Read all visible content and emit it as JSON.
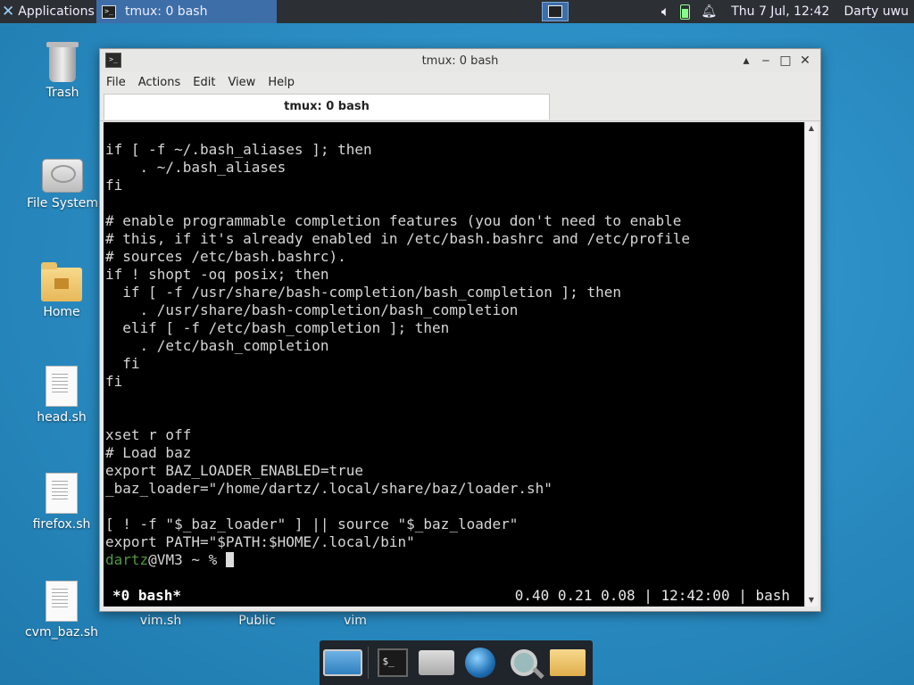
{
  "top_panel": {
    "apps_label": "Applications",
    "task_title": "tmux: 0 bash",
    "clock": "Thu  7 Jul, 12:42",
    "user": "Darty uwu",
    "icons": [
      "xfce-logo-icon",
      "terminal-icon",
      "workspace-icon",
      "volume-icon",
      "battery-icon",
      "notification-bell-icon"
    ]
  },
  "desktop": {
    "icons": [
      {
        "label": "Trash",
        "icon": "trash-icon"
      },
      {
        "label": "File System",
        "icon": "drive-icon"
      },
      {
        "label": "Home",
        "icon": "home-folder-icon"
      },
      {
        "label": "head.sh",
        "icon": "document-icon"
      },
      {
        "label": "firefox.sh",
        "icon": "document-icon"
      },
      {
        "label": "cvm_baz.sh",
        "icon": "document-icon"
      },
      {
        "label": "vim.sh",
        "icon": "document-icon"
      },
      {
        "label": "Public",
        "icon": "folder-icon"
      },
      {
        "label": "vim",
        "icon": "document-icon"
      }
    ]
  },
  "window": {
    "title": "tmux: 0 bash",
    "buttons": [
      "▴",
      "‒",
      "□",
      "✕"
    ],
    "menu": [
      "File",
      "Actions",
      "Edit",
      "View",
      "Help"
    ],
    "tab_label": "tmux: 0 bash",
    "terminal_text": "if [ -f ~/.bash_aliases ]; then\n    . ~/.bash_aliases\nfi\n\n# enable programmable completion features (you don't need to enable\n# this, if it's already enabled in /etc/bash.bashrc and /etc/profile\n# sources /etc/bash.bashrc).\nif ! shopt -oq posix; then\n  if [ -f /usr/share/bash-completion/bash_completion ]; then\n    . /usr/share/bash-completion/bash_completion\n  elif [ -f /etc/bash_completion ]; then\n    . /etc/bash_completion\n  fi\nfi\n\n\nxset r off\n# Load baz\nexport BAZ_LOADER_ENABLED=true\n_baz_loader=\"/home/dartz/.local/share/baz/loader.sh\"\n\n[ ! -f \"$_baz_loader\" ] || source \"$_baz_loader\"\nexport PATH=\"$PATH:$HOME/.local/bin\"\n",
    "prompt_user": "dartz",
    "prompt_rest": "@VM3 ~ % ",
    "status_window": "*0 bash*",
    "status_right": "0.40 0.21 0.08 | 12:42:00 | bash"
  },
  "dock": {
    "items": [
      "show-desktop-icon",
      "terminal-icon",
      "home-folder-icon",
      "web-browser-icon",
      "search-icon",
      "folder-icon"
    ]
  }
}
